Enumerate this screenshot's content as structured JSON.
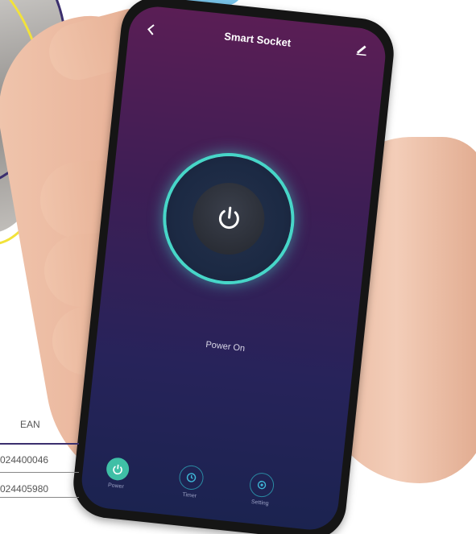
{
  "app": {
    "title": "Smart Socket",
    "back_icon": "chevron-left-icon",
    "edit_icon": "pencil-icon"
  },
  "power": {
    "icon": "power-icon",
    "status": "Power On",
    "state_on": true,
    "accent_color": "#47d6c8"
  },
  "tabs": [
    {
      "label": "Power",
      "icon": "power-icon",
      "active": true
    },
    {
      "label": "Timer",
      "icon": "clock-icon",
      "active": false
    },
    {
      "label": "Setting",
      "icon": "gear-icon",
      "active": false
    }
  ],
  "ean_table": {
    "header": "EAN",
    "rows": [
      "024400046",
      "024405980"
    ]
  },
  "colors": {
    "screen_top": "#5a1e55",
    "screen_bottom": "#1b2350",
    "active_tab": "#3fbfa6"
  }
}
